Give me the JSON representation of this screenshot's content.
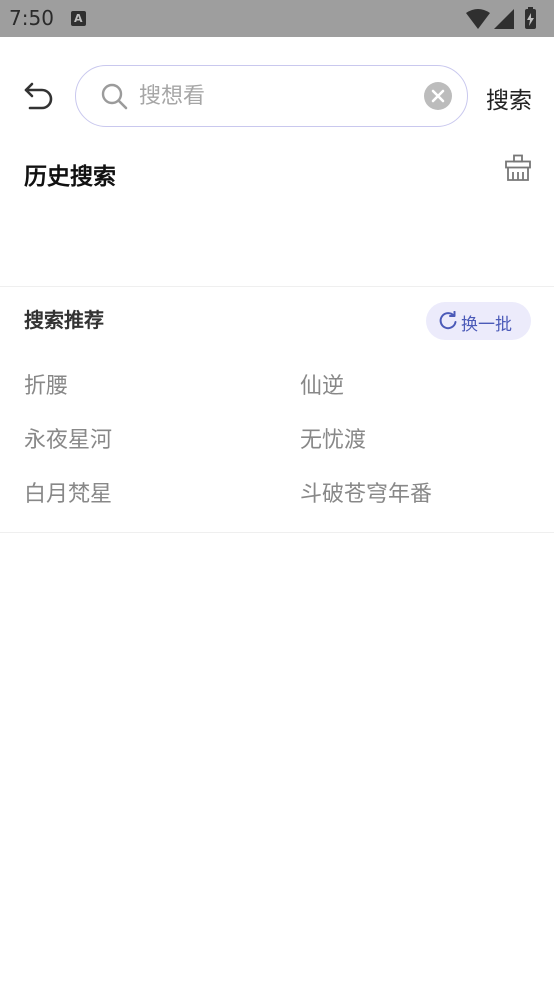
{
  "status_bar": {
    "time": "7:50",
    "notification_icon": "A"
  },
  "search": {
    "placeholder": "搜想看",
    "submit_label": "搜索"
  },
  "history": {
    "title": "历史搜索"
  },
  "recommend": {
    "title": "搜索推荐",
    "refresh_label": "换一批",
    "items": [
      "折腰",
      "仙逆",
      "永夜星河",
      "无忧渡",
      "白月梵星",
      "斗破苍穹年番"
    ]
  },
  "colors": {
    "accent": "#4b5ab8",
    "accent_bg": "#ecebfb",
    "status_bar": "#9e9e9e"
  }
}
